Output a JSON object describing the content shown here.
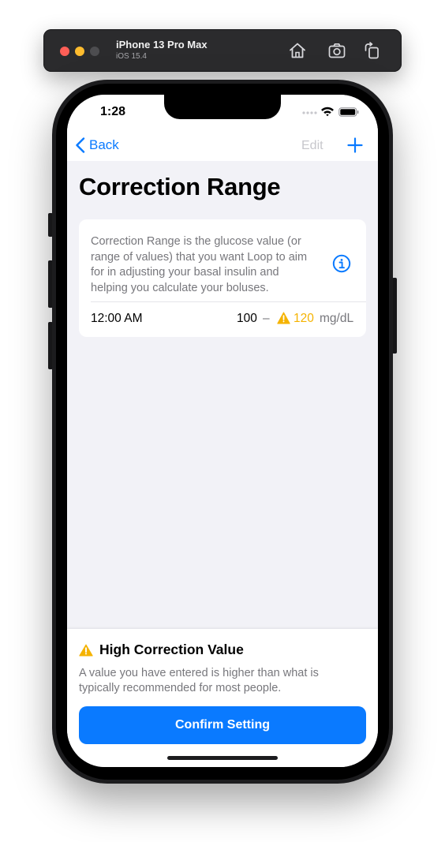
{
  "simulator": {
    "device_name": "iPhone 13 Pro Max",
    "os_version": "iOS 15.4",
    "buttons": [
      "home-icon",
      "screenshot-icon",
      "rotate-icon"
    ]
  },
  "status_bar": {
    "time": "1:28"
  },
  "nav": {
    "back_label": "Back",
    "edit_label": "Edit",
    "add_icon": "plus-icon"
  },
  "page": {
    "title": "Correction Range"
  },
  "card": {
    "description": "Correction Range is the glucose value (or range of values) that you want Loop to aim for in adjusting your basal insulin and helping you calculate your boluses.",
    "info_icon": "info-icon",
    "schedule": [
      {
        "time": "12:00 AM",
        "lower": "100",
        "separator": "–",
        "upper": "120",
        "unit": "mg/dL",
        "upper_warning": true
      }
    ]
  },
  "warning_sheet": {
    "title": "High Correction Value",
    "body": "A value you have entered is higher than what is typically recommended for most people.",
    "confirm_label": "Confirm Setting"
  },
  "colors": {
    "accent": "#0a7aff",
    "warning": "#f5b300",
    "background": "#f2f2f7",
    "secondary_text": "#77777c"
  }
}
